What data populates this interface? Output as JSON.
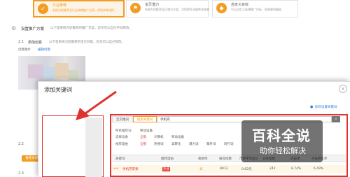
{
  "cards": [
    {
      "icon": "check-mark-icon",
      "title": "行业推荐",
      "desc": "系统为您推荐全行业热销推广方案，供您参考选择"
    },
    {
      "icon": "flag-icon",
      "title": "宝贝潜力",
      "desc": "系统为您推荐宝贝潜力方案，为您提升流量转化效果"
    },
    {
      "icon": "diamond-icon",
      "title": "自定义目标",
      "desc": "可以自定义选择推广目标，投放更加精准"
    }
  ],
  "section_title": "设置推广方案",
  "section_hint": "以下是系统为您推荐的推广方案，您也可以自己手动修改。",
  "step1": {
    "num": "2.1",
    "label": "添加创意",
    "hint": "以下是系统为您推荐的宝贝创意，您也可以自己修改。",
    "sub_label": "创意图片",
    "sub_link": "编辑创意"
  },
  "step2": {
    "num": "2.2",
    "label": "",
    "btn": "推荐关键词"
  },
  "step3": {
    "num": "2.3",
    "label": ""
  },
  "watermark": {
    "title": "百科全说",
    "subtitle": "助你轻松解决"
  },
  "dialog": {
    "title": "添加关键词",
    "close": "×",
    "help_link": "如何设置关键词",
    "tabs": [
      "宝贝推词",
      "搜索关键词",
      "手机壳"
    ],
    "search_value": "手机壳",
    "filter_rows": [
      {
        "label": "所有推荐词",
        "options": [
          "移动设备"
        ]
      },
      {
        "label": "选择设备",
        "options": [
          "全部",
          "计算机",
          "移动设备"
        ]
      },
      {
        "label": "推荐理由",
        "options": [
          "全部",
          "热搜词",
          "高转化",
          "潜力词",
          "飙升词",
          "同行词"
        ]
      }
    ],
    "table_headers": [
      "关键词",
      "推荐理由",
      "相关性",
      "展现指数",
      "市场平均出价",
      "竞争指数",
      "点击率",
      "点击转化率"
    ],
    "table_row": [
      "手机壳苹果",
      "热搜",
      "高",
      "8913",
      "0.62元",
      "242",
      "8.74%",
      "6.49%"
    ],
    "row_prefix": "<<"
  }
}
